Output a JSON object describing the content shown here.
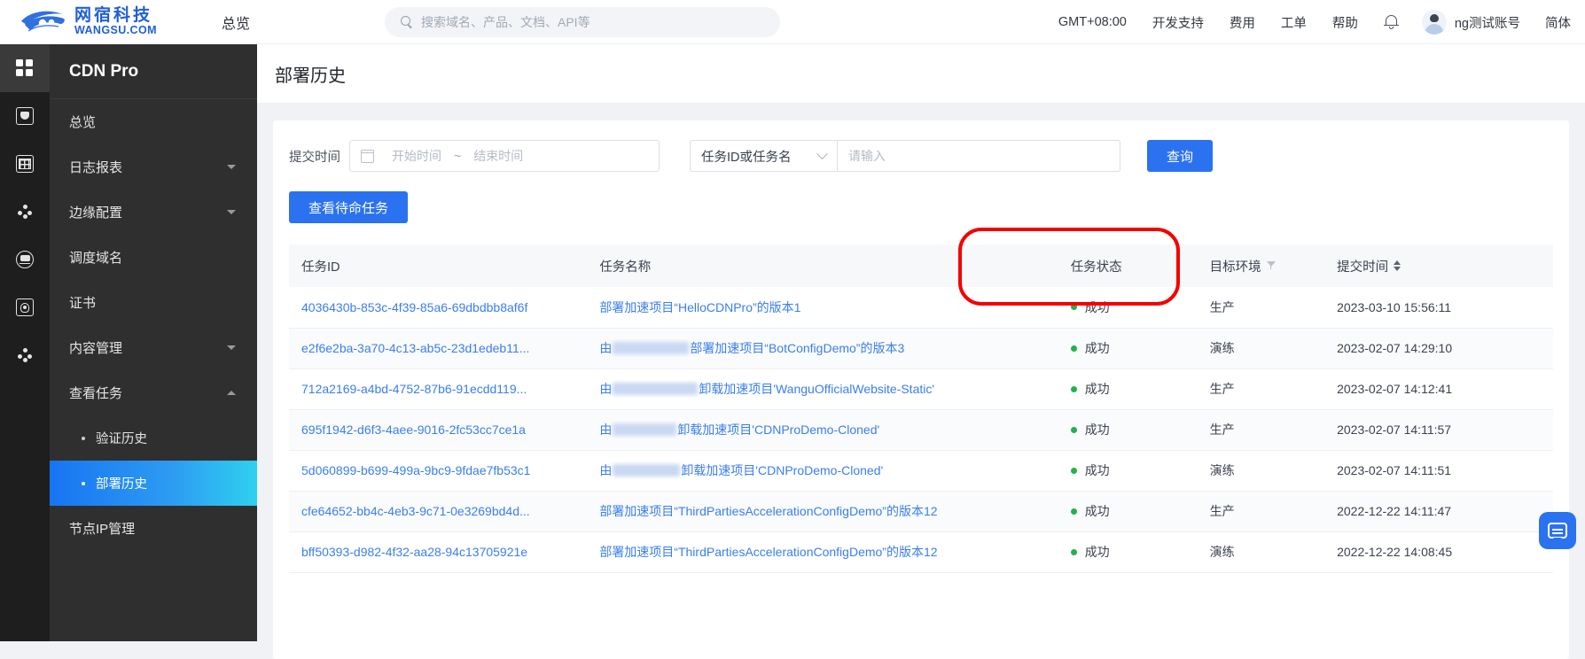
{
  "topbar": {
    "brand_cn": "网宿科技",
    "brand_en": "WANGSU.COM",
    "nav_overview": "总览",
    "search_placeholder": "搜索域名、产品、文档、API等",
    "timezone": "GMT+08:00",
    "links": [
      "开发支持",
      "费用",
      "工单",
      "帮助"
    ],
    "user_name": "ng测试账号",
    "language": "简体"
  },
  "rail": {
    "items": [
      {
        "name": "apps-icon"
      },
      {
        "name": "shield-icon"
      },
      {
        "name": "report-table-icon"
      },
      {
        "name": "nodes-icon"
      },
      {
        "name": "balance-icon"
      },
      {
        "name": "certificate-icon"
      },
      {
        "name": "cluster-icon"
      }
    ]
  },
  "sidebar": {
    "title": "CDN Pro",
    "items": [
      {
        "label": "总览",
        "expandable": false
      },
      {
        "label": "日志报表",
        "expandable": true,
        "open": false
      },
      {
        "label": "边缘配置",
        "expandable": true,
        "open": false
      },
      {
        "label": "调度域名",
        "expandable": false
      },
      {
        "label": "证书",
        "expandable": false
      },
      {
        "label": "内容管理",
        "expandable": true,
        "open": false
      },
      {
        "label": "查看任务",
        "expandable": true,
        "open": true
      }
    ],
    "sub_items": [
      {
        "label": "验证历史",
        "active": false
      },
      {
        "label": "部署历史",
        "active": true
      }
    ],
    "last_item": {
      "label": "节点IP管理"
    }
  },
  "page": {
    "title": "部署历史"
  },
  "filters": {
    "submit_time_label": "提交时间",
    "start_placeholder": "开始时间",
    "separator": "~",
    "end_placeholder": "结束时间",
    "select_value": "任务ID或任务名",
    "input_placeholder": "请输入",
    "query_button": "查询",
    "standby_button": "查看待命任务"
  },
  "table": {
    "columns": [
      {
        "key": "id",
        "label": "任务ID",
        "icon": null
      },
      {
        "key": "name",
        "label": "任务名称",
        "icon": null
      },
      {
        "key": "state",
        "label": "任务状态",
        "icon": null
      },
      {
        "key": "env",
        "label": "目标环境",
        "icon": "filter-icon"
      },
      {
        "key": "time",
        "label": "提交时间",
        "icon": "sort-icon"
      }
    ],
    "rows": [
      {
        "id": "4036430b-853c-4f39-85a6-69dbdbb8af6f",
        "name_prefix": "部署加速项目“HelloCDNPro”的版本1",
        "redacted": false,
        "name_suffix": "",
        "state": "成功",
        "env": "生产",
        "time": "2023-03-10 15:56:11"
      },
      {
        "id": "e2f6e2ba-3a70-4c13-ab5c-23d1edeb11...",
        "name_prefix": "由",
        "redacted": true,
        "redact_width": 86,
        "name_suffix": "部署加速项目“BotConfigDemo”的版本3",
        "state": "成功",
        "env": "演练",
        "time": "2023-02-07 14:29:10"
      },
      {
        "id": "712a2169-a4bd-4752-87b6-91ecdd119...",
        "name_prefix": "由",
        "redacted": true,
        "redact_width": 96,
        "name_suffix": "卸载加速项目'WanguOfficialWebsite-Static'",
        "state": "成功",
        "env": "生产",
        "time": "2023-02-07 14:12:41"
      },
      {
        "id": "695f1942-d6f3-4aee-9016-2fc53cc7ce1a",
        "name_prefix": "由",
        "redacted": true,
        "redact_width": 72,
        "name_suffix": "卸载加速项目'CDNProDemo-Cloned'",
        "state": "成功",
        "env": "生产",
        "time": "2023-02-07 14:11:57"
      },
      {
        "id": "5d060899-b699-499a-9bc9-9fdae7fb53c1",
        "name_prefix": "由",
        "redacted": true,
        "redact_width": 76,
        "name_suffix": "卸载加速项目'CDNProDemo-Cloned'",
        "state": "成功",
        "env": "演练",
        "time": "2023-02-07 14:11:51"
      },
      {
        "id": "cfe64652-bb4c-4eb3-9c71-0e3269bd4d...",
        "name_prefix": "部署加速项目“ThirdPartiesAccelerationConfigDemo”的版本12",
        "redacted": false,
        "name_suffix": "",
        "state": "成功",
        "env": "生产",
        "time": "2022-12-22 14:11:47"
      },
      {
        "id": "bff50393-d982-4f32-aa28-94c13705921e",
        "name_prefix": "部署加速项目“ThirdPartiesAccelerationConfigDemo”的版本12",
        "redacted": false,
        "name_suffix": "",
        "state": "成功",
        "env": "演练",
        "time": "2022-12-22 14:08:45"
      }
    ]
  },
  "colors": {
    "accent": "#2b72f0",
    "success": "#22b14c",
    "link": "#3a7ef0",
    "annotation": "#f40000",
    "sidebar_bg": "#2f2f2f",
    "rail_bg": "#1e1e1e"
  }
}
